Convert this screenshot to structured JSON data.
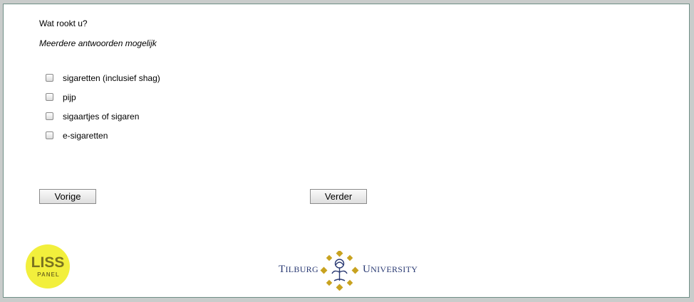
{
  "question": {
    "text": "Wat rookt u?",
    "instruction": "Meerdere antwoorden mogelijk"
  },
  "options": [
    {
      "label": "sigaretten (inclusief shag)",
      "checked": false
    },
    {
      "label": "pijp",
      "checked": false
    },
    {
      "label": "sigaartjes of sigaren",
      "checked": false
    },
    {
      "label": "e-sigaretten",
      "checked": false
    }
  ],
  "navigation": {
    "prev_label": "Vorige",
    "next_label": "Verder"
  },
  "logos": {
    "liss": {
      "line1": "LISS",
      "line2": "PANEL"
    },
    "tilburg": {
      "word1": "Tilburg",
      "word2": "University"
    }
  },
  "colors": {
    "liss_yellow": "#f2ef3c",
    "liss_text": "#7a7320",
    "tilburg_blue": "#2a3a73",
    "tilburg_gold": "#c8a21f",
    "frame_border": "#6f8f86"
  }
}
